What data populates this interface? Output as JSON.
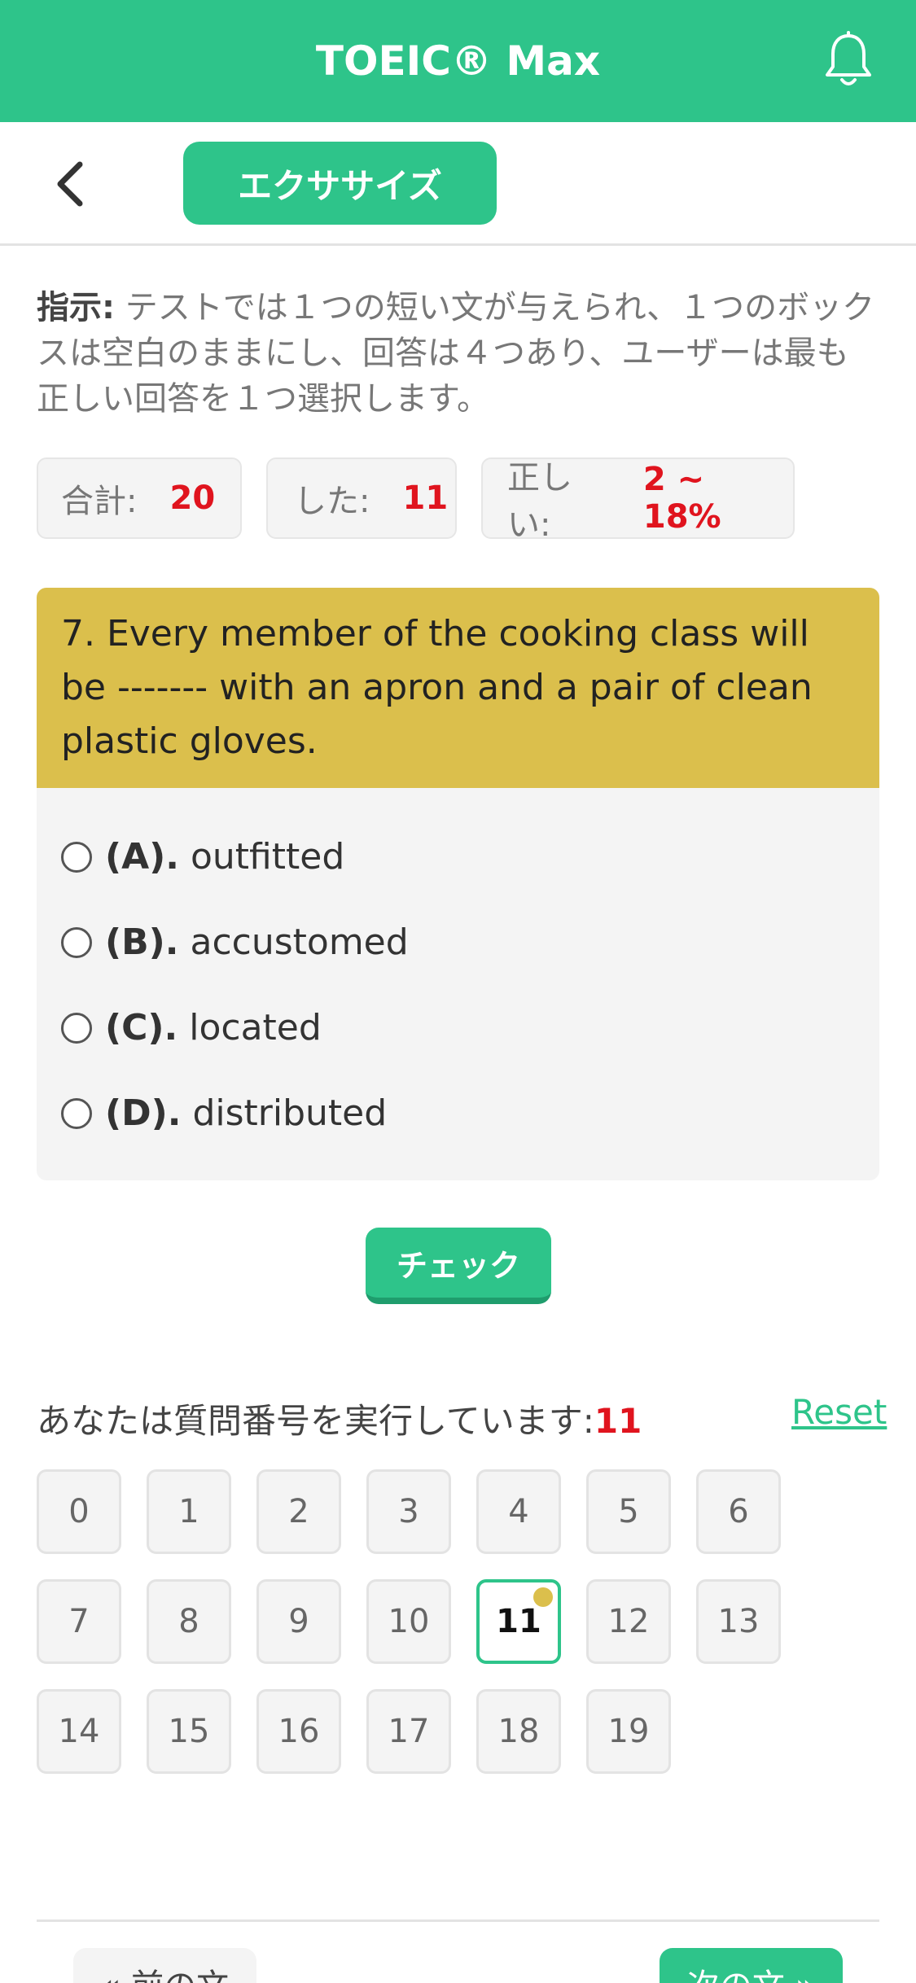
{
  "header": {
    "title": "TOEIC® Max",
    "bell_icon": "bell-icon"
  },
  "subbar": {
    "back_icon": "chevron-left-icon",
    "tab_label": "エクササイズ"
  },
  "instruction": {
    "label": "指示:",
    "text": " テストでは１つの短い文が与えられ、１つのボックスは空白のままにし、回答は４つあり、ユーザーは最も正しい回答を１つ選択します。"
  },
  "stats": {
    "total_label": "合計:",
    "total_value": "20",
    "done_label": "した:",
    "done_value": "11",
    "correct_label": "正しい:",
    "correct_value": "2 ~ 18%"
  },
  "question": {
    "text": "7. Every member of the cooking class will be ------- with an apron and a pair of clean plastic gloves.",
    "options": [
      {
        "key": "(A).",
        "text": "outfitted"
      },
      {
        "key": "(B).",
        "text": "accustomed"
      },
      {
        "key": "(C).",
        "text": "located"
      },
      {
        "key": "(D).",
        "text": "distributed"
      }
    ]
  },
  "check_label": "チェック",
  "progress": {
    "label": "あなたは質問番号を実行しています:",
    "current": "11",
    "reset_label": "Reset"
  },
  "question_numbers": [
    "0",
    "1",
    "2",
    "3",
    "4",
    "5",
    "6",
    "7",
    "8",
    "9",
    "10",
    "11",
    "12",
    "13",
    "14",
    "15",
    "16",
    "17",
    "18",
    "19"
  ],
  "footer": {
    "prev_label": "« 前の文",
    "next_label": "次の文 »"
  },
  "colors": {
    "accent": "#2ec48a",
    "question_bg": "#dbbf4c",
    "highlight": "#e0141e"
  }
}
